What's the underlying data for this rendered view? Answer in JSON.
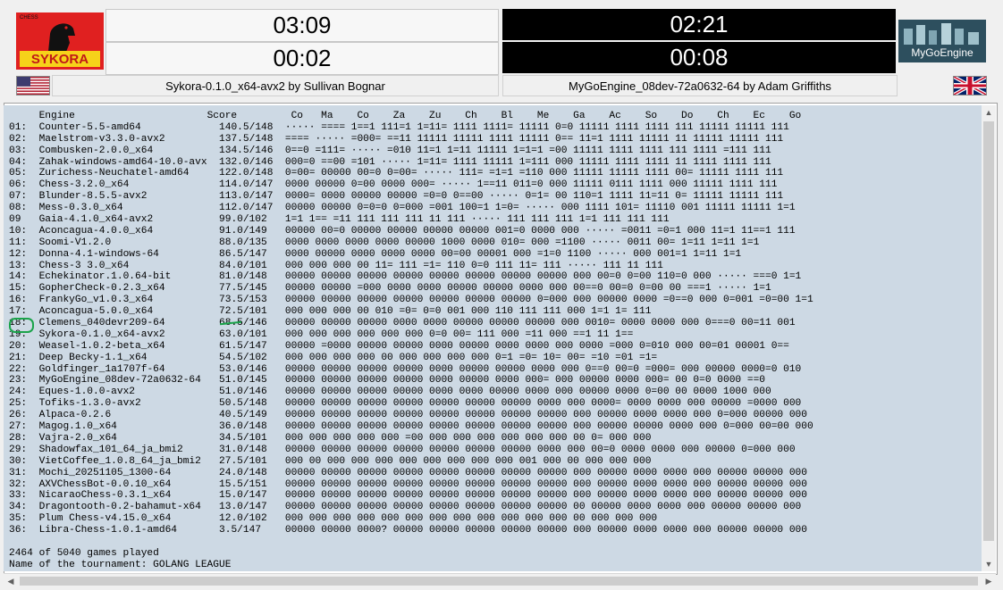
{
  "clock_panel": {
    "left": {
      "logo_text": "SYKORA",
      "logo_subtext": "CHESS",
      "time_top": "03:09",
      "time_bottom": "00:02",
      "engine": "Sykora-0.1.0_x64-avx2 by Sullivan Bognar",
      "flag": "us-flag-icon"
    },
    "right": {
      "logo_text": "MyGoEngine",
      "time_top": "02:21",
      "time_bottom": "00:08",
      "engine": "MyGoEngine_08dev-72a0632-64 by Adam Griffiths",
      "flag": "uk-flag-icon"
    }
  },
  "crosstable": {
    "header": {
      "engine_label": "Engine",
      "score_label": "Score",
      "opponents": "Co   Ma    Co    Za    Zu    Ch    Bl    Me    Ga    Ac    So    Do    Ch    Ec    Go"
    },
    "rows": [
      {
        "rank": "01:",
        "engine": "Counter-5.5-amd64",
        "score": "140.5/148",
        "results": "····· ==== 1==1 111=1 1=11= 1111 1111= 11111 0=0 11111 1111 1111 111 11111 11111 111"
      },
      {
        "rank": "02:",
        "engine": "Maelstrom-v3.3.0-avx2",
        "score": "137.5/148",
        "results": "==== ····· =000= ==11 11111 11111 1111 11111 0== 11=1 1111 11111 11 11111 11111 111"
      },
      {
        "rank": "03:",
        "engine": "Combusken-2.0.0_x64",
        "score": "134.5/146",
        "results": "0==0 =111= ····· =010 11=1 1=11 11111 1=1=1 =00 11111 1111 1111 111 1111 =111 111"
      },
      {
        "rank": "04:",
        "engine": "Zahak-windows-amd64-10.0-avx",
        "score": "132.0/146",
        "results": "000=0 ==00 =101 ····· 1=11= 1111 11111 1=111 000 11111 1111 1111 11 1111 1111 111"
      },
      {
        "rank": "05:",
        "engine": "Zurichess-Neuchatel-amd64",
        "score": "122.0/148",
        "results": "0=00= 00000 00=0 0=00= ····· 111= =1=1 =110 000 11111 11111 1111 00= 11111 1111 111"
      },
      {
        "rank": "06:",
        "engine": "Chess-3.2.0_x64",
        "score": "114.0/147",
        "results": "0000 00000 0=00 0000 000= ····· 1==11 011=0 000 11111 0111 1111 000 11111 1111 111"
      },
      {
        "rank": "07:",
        "engine": "Blunder-8.5.5-avx2",
        "score": "113.0/147",
        "results": "0000= 0000 00000 00000 =0=0 0==00 ····· 0=1= 00 110=1 1111 11=11 0= 11111 11111 111"
      },
      {
        "rank": "08:",
        "engine": "Mess-0.3.0_x64",
        "score": "112.0/147",
        "results": "00000 00000 0=0=0 0=000 =001 100=1 1=0= ····· 000 1111 101= 11110 001 11111 11111 1=1"
      },
      {
        "rank": "09",
        "engine": "Gaia-4.1.0_x64-avx2",
        "score": "99.0/102",
        "results": "1=1 1== =11 111 111 111 11 111 ····· 111 111 111 1=1 111 111 111"
      },
      {
        "rank": "10:",
        "engine": "Aconcagua-4.0.0_x64",
        "score": "91.0/149",
        "results": "00000 00=0 00000 00000 00000 00000 001=0 0000 000 ····· =0011 =0=1 000 11=1 11==1 111"
      },
      {
        "rank": "11:",
        "engine": "Soomi-V1.2.0",
        "score": "88.0/135",
        "results": "0000 0000 0000 0000 00000 1000 0000 010= 000 =1100 ····· 0011 00= 1=11 1=11 1=1"
      },
      {
        "rank": "12:",
        "engine": "Donna-4.1-windows-64",
        "score": "86.5/147",
        "results": "0000 00000 0000 0000 0000 00=00 00001 000 =1=0 1100 ····· 000 001=1 1=11 1=1"
      },
      {
        "rank": "13:",
        "engine": "Chess-3 3.0_x64",
        "score": "84.0/101",
        "results": "000 000 000 00 11= 111 =1= 110 0=0 111 11= 111 ····· 111 11 111"
      },
      {
        "rank": "14:",
        "engine": "Echekinator.1.0.64-bit",
        "score": "81.0/148",
        "results": "00000 00000 00000 00000 00000 00000 00000 00000 000 00=0 0=00 110=0 000 ····· ===0 1=1"
      },
      {
        "rank": "15:",
        "engine": "GopherCheck-0.2.3_x64",
        "score": "77.5/145",
        "results": "00000 00000 =000 0000 0000 00000 00000 0000 000 00==0 00=0 0=00 00 ===1 ····· 1=1"
      },
      {
        "rank": "16:",
        "engine": "FrankyGo_v1.0.3_x64",
        "score": "73.5/153",
        "results": "00000 00000 00000 00000 00000 00000 00000 0=000 000 00000 0000 =0==0 000 0=001 =0=00 1=1"
      },
      {
        "rank": "17:",
        "engine": "Aconcagua-5.0.0_x64",
        "score": "72.5/101",
        "results": "000 000 000 00 010 =0= 0=0 001 000 110 111 111 000 1=1 1= 111"
      },
      {
        "rank": "18:",
        "engine": "Clemens_040devr209-64",
        "score": "68.5/146",
        "results": "00000 00000 00000 0000 0000 00000 00000 00000 000 0010= 0000 0000 000 0===0 00=11 001"
      },
      {
        "rank": "19:",
        "engine": "Sykora-0.1.0_x64-avx2",
        "score": "63.0/101",
        "results": "000 000 000 000 000 000 0=0 00= 111 000 =11 000 ==1 11 1=="
      },
      {
        "rank": "20:",
        "engine": "Weasel-1.0.2-beta_x64",
        "score": "61.5/147",
        "results": "00000 =0000 00000 00000 0000 00000 0000 0000 000 0000 =000 0=010 000 00=01 00001 0=="
      },
      {
        "rank": "21:",
        "engine": "Deep Becky-1.1_x64",
        "score": "54.5/102",
        "results": "000 000 000 000 00 000 000 000 000 0=1 =0= 10= 00= =10 =01 =1="
      },
      {
        "rank": "22:",
        "engine": "Goldfinger_1a1707f-64",
        "score": "53.0/146",
        "results": "00000 00000 00000 00000 0000 00000 00000 0000 000 0==0 00=0 =000= 000 00000 0000=0 010"
      },
      {
        "rank": "23:",
        "engine": "MyGoEngine_08dev-72a0632-64",
        "score": "51.0/145",
        "results": "00000 00000 00000 00000 0000 00000 0000 000= 000 00000 0000 000= 00 0=0 0000 ==0"
      },
      {
        "rank": "24:",
        "engine": "Eques-1.0.0-avx2",
        "score": "51.0/146",
        "results": "00000 00000 00000 00000 0000 0000 00000 0000 000 00000 0000 0=00 00 0000 1000 000"
      },
      {
        "rank": "25:",
        "engine": "Tofiks-1.3.0-avx2",
        "score": "50.5/148",
        "results": "00000 00000 00000 00000 00000 00000 00000 0000 000 0000= 0000 0000 000 00000 =0000 000"
      },
      {
        "rank": "26:",
        "engine": "Alpaca-0.2.6",
        "score": "40.5/149",
        "results": "00000 00000 00000 00000 00000 00000 00000 00000 000 00000 0000 0000 000 0=000 00000 000"
      },
      {
        "rank": "27:",
        "engine": "Magog.1.0_x64",
        "score": "36.0/148",
        "results": "00000 00000 00000 00000 00000 00000 00000 00000 000 00000 00000 0000 000 0=000 00=00 000"
      },
      {
        "rank": "28:",
        "engine": "Vajra-2.0_x64",
        "score": "34.5/101",
        "results": "000 000 000 000 000 =00 000 000 000 000 000 000 00 0= 000 000"
      },
      {
        "rank": "29:",
        "engine": "Shadowfax_101_64_ja_bmi2",
        "score": "31.0/148",
        "results": "00000 00000 00000 00000 00000 00000 00000 0000 000 00=0 0000 0000 000 00000 0=000 000"
      },
      {
        "rank": "30:",
        "engine": "VietCoffee_1.0.8_64_ja_bmi2",
        "score": "27.5/101",
        "results": "000 00 000 000 000 000 000 000 000 000 001 000 00 000 000 000"
      },
      {
        "rank": "31:",
        "engine": "Mochi_20251105_1300-64",
        "score": "24.0/148",
        "results": "00000 00000 00000 00000 00000 00000 00000 00000 000 00000 0000 0000 000 00000 00000 000"
      },
      {
        "rank": "32:",
        "engine": "AXVChessBot-0.0.10_x64",
        "score": "15.5/151",
        "results": "00000 00000 00000 00000 00000 00000 00000 00000 000 00000 0000 0000 000 00000 00000 000"
      },
      {
        "rank": "33:",
        "engine": "NicaraoChess-0.3.1_x64",
        "score": "15.0/147",
        "results": "00000 00000 00000 00000 00000 00000 00000 00000 000 00000 0000 0000 000 00000 00000 000"
      },
      {
        "rank": "34:",
        "engine": "Dragontooth-0.2-bahamut-x64",
        "score": "13.0/147",
        "results": "00000 00000 00000 00000 00000 00000 00000 00000 00 00000 0000 0000 000 00000 00000 000"
      },
      {
        "rank": "35:",
        "engine": "Plum Chess-v4.15.0_x64",
        "score": "12.0/102",
        "results": "000 000 000 000 000 000 000 000 000 000 000 000 00 000 000 000"
      },
      {
        "rank": "36:",
        "engine": "Libra-Chess-1.0.1-amd64",
        "score": "3.5/147",
        "results": "00000 00000 0000? 00000 00000 00000 00000 00000 000 00000 0000 0000 000 00000 00000 000"
      }
    ],
    "footer": {
      "games_played": "2464 of 5040 games played",
      "tournament": "Name of the tournament: GOLANG LEAGUE"
    }
  },
  "scrollbars": {
    "up_arrow": "▲",
    "down_arrow": "▼",
    "left_arrow": "◀",
    "right_arrow": "▶"
  }
}
